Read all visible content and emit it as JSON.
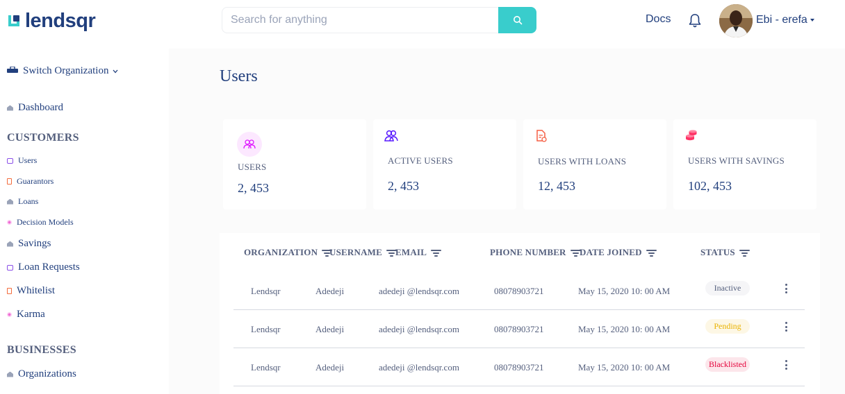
{
  "app": {
    "logo_text": "lendsqr",
    "brand_color": "#39cdcc",
    "text_color": "#213f7d"
  },
  "header": {
    "search_placeholder": "Search for anything",
    "docs_label": "Docs",
    "user_name": "Ebi - erefa"
  },
  "sidebar": {
    "switch_org": "Switch Organization",
    "dashboard": "Dashboard",
    "customers_heading": "CUSTOMERS",
    "customers": [
      {
        "label": "Users",
        "icon": "users-icon"
      },
      {
        "label": "Guarantors",
        "icon": "guarantors-icon"
      },
      {
        "label": "Loans",
        "icon": "loans-icon"
      },
      {
        "label": "Decision Models",
        "icon": "decision-models-icon"
      },
      {
        "label": "Savings",
        "icon": "savings-icon"
      },
      {
        "label": "Loan Requests",
        "icon": "loan-requests-icon"
      },
      {
        "label": "Whitelist",
        "icon": "whitelist-icon"
      },
      {
        "label": "Karma",
        "icon": "karma-icon"
      }
    ],
    "businesses_heading": "BUSINESSES",
    "businesses": [
      {
        "label": "Organizations",
        "icon": "organizations-icon"
      }
    ]
  },
  "main": {
    "title": "Users",
    "cards": [
      {
        "label": "USERS",
        "value": "2, 453",
        "color": "#df18ff"
      },
      {
        "label": "ACTIVE USERS",
        "value": "2, 453",
        "color": "#5718ff"
      },
      {
        "label": "USERS WITH LOANS",
        "value": "12, 453",
        "color": "#f55f44"
      },
      {
        "label": "USERS WITH SAVINGS",
        "value": "102, 453",
        "color": "#ff3366"
      }
    ],
    "table": {
      "headers": [
        "ORGANIZATION",
        "USERNAME",
        "EMAIL",
        "PHONE NUMBER",
        "DATE JOINED",
        "STATUS"
      ],
      "rows": [
        {
          "organization": "Lendsqr",
          "username": "Adedeji",
          "email": "adedeji @lendsqr.com",
          "phone": "08078903721",
          "date": "May 15, 2020 10: 00 AM",
          "status": "Inactive"
        },
        {
          "organization": "Lendsqr",
          "username": "Adedeji",
          "email": "adedeji @lendsqr.com",
          "phone": "08078903721",
          "date": "May 15, 2020 10: 00 AM",
          "status": "Pending"
        },
        {
          "organization": "Lendsqr",
          "username": "Adedeji",
          "email": "adedeji @lendsqr.com",
          "phone": "08078903721",
          "date": "May 15, 2020 10: 00 AM",
          "status": "Blacklisted"
        }
      ],
      "status_colors": {
        "Inactive": {
          "bg": "#f5f5f7",
          "fg": "#545f7d"
        },
        "Pending": {
          "bg": "#fdf7e5",
          "fg": "#e9b200"
        },
        "Blacklisted": {
          "bg": "#fce6eb",
          "fg": "#e4033b"
        }
      }
    }
  }
}
